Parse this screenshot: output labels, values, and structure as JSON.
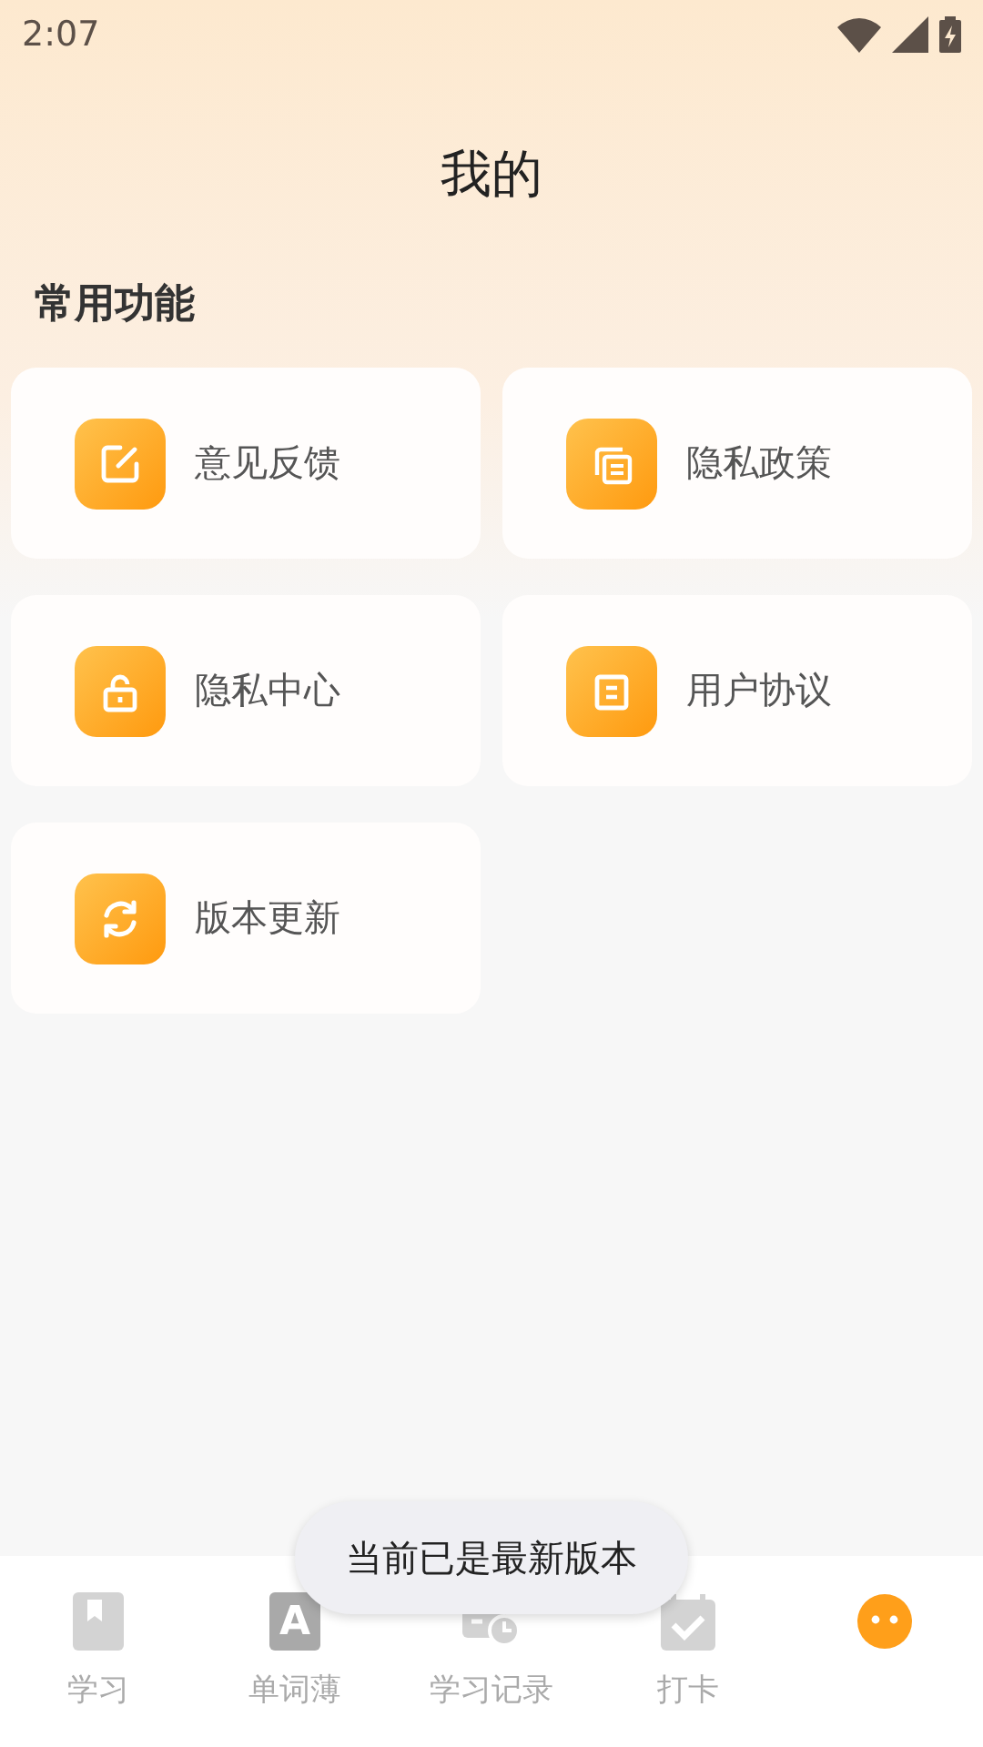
{
  "status_bar": {
    "time": "2:07"
  },
  "title": "我的",
  "section": {
    "heading": "常用功能",
    "items": [
      {
        "label": "意见反馈"
      },
      {
        "label": "隐私政策"
      },
      {
        "label": "隐私中心"
      },
      {
        "label": "用户协议"
      },
      {
        "label": "版本更新"
      }
    ]
  },
  "toast": "当前已是最新版本",
  "tabs": [
    {
      "label": "学习",
      "selected": false
    },
    {
      "label": "单词薄",
      "glyph": "A",
      "selected": false
    },
    {
      "label": "学习记录",
      "selected": false
    },
    {
      "label": "打卡",
      "selected": false
    },
    {
      "selected": true
    }
  ]
}
